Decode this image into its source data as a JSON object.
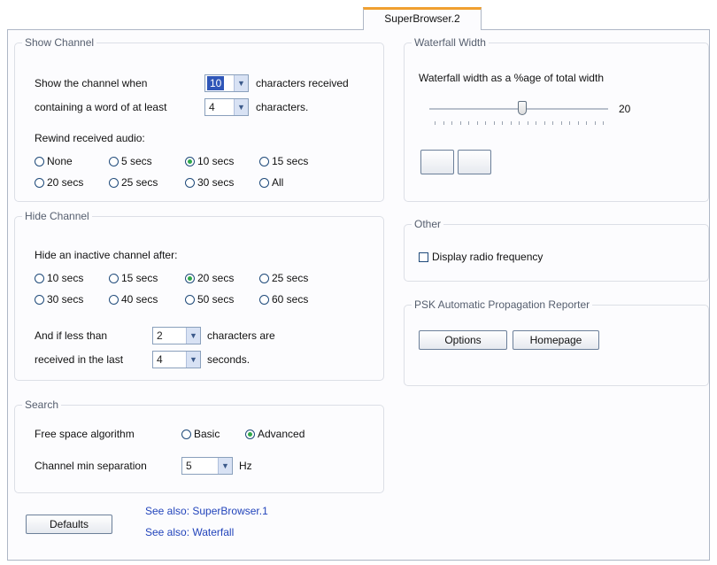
{
  "tab": {
    "label": "SuperBrowser.2"
  },
  "show_channel": {
    "legend": "Show Channel",
    "show_when_label": "Show the channel when",
    "chars_value": "10",
    "chars_received_label": "characters received",
    "containing_label": "containing a word of at least",
    "word_value": "4",
    "characters_label": "characters.",
    "rewind_label": "Rewind received audio:",
    "rewind_options": [
      "None",
      "5 secs",
      "10 secs",
      "15 secs",
      "20 secs",
      "25 secs",
      "30 secs",
      "All"
    ],
    "rewind_selected": "10 secs"
  },
  "hide_channel": {
    "legend": "Hide Channel",
    "hide_after_label": "Hide an inactive channel after:",
    "options": [
      "10 secs",
      "15 secs",
      "20 secs",
      "25 secs",
      "30 secs",
      "40 secs",
      "50 secs",
      "60 secs"
    ],
    "selected": "20 secs",
    "and_if_label": "And if less than",
    "chars_value": "2",
    "chars_are_label": "characters are",
    "received_last_label": "received in the last",
    "seconds_value": "4",
    "seconds_label": "seconds."
  },
  "search": {
    "legend": "Search",
    "free_space_label": "Free space algorithm",
    "algorithm_options": [
      "Basic",
      "Advanced"
    ],
    "algorithm_selected": "Advanced",
    "min_sep_label": "Channel min separation",
    "min_sep_value": "5",
    "hz_label": "Hz"
  },
  "defaults_button": "Defaults",
  "links": [
    "See also: SuperBrowser.1",
    "See also: Waterfall"
  ],
  "waterfall_width": {
    "legend": "Waterfall Width",
    "label": "Waterfall width as a %age of total width",
    "value": "20",
    "slider_fraction": 0.52
  },
  "other": {
    "legend": "Other",
    "display_freq_label": "Display radio frequency",
    "display_freq_checked": false
  },
  "psk": {
    "legend": "PSK Automatic Propagation Reporter",
    "options_button": "Options",
    "homepage_button": "Homepage"
  }
}
